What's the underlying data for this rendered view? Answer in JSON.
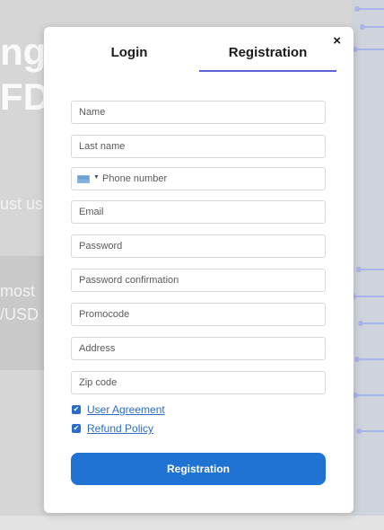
{
  "background": {
    "big_text_1": "ng",
    "big_text_2": "FD",
    "text_1": "ust us",
    "text_2": "most",
    "text_3": "/USD"
  },
  "modal": {
    "close_label": "×",
    "tabs": [
      {
        "label": "Login",
        "active": false
      },
      {
        "label": "Registration",
        "active": true
      }
    ],
    "fields": {
      "name": {
        "placeholder": "Name",
        "value": ""
      },
      "last_name": {
        "placeholder": "Last name",
        "value": ""
      },
      "phone": {
        "placeholder": "Phone number",
        "value": "",
        "flag": "flag-icon"
      },
      "email": {
        "placeholder": "Email",
        "value": ""
      },
      "password": {
        "placeholder": "Password",
        "value": ""
      },
      "password_confirmation": {
        "placeholder": "Password confirmation",
        "value": ""
      },
      "promocode": {
        "placeholder": "Promocode",
        "value": ""
      },
      "address": {
        "placeholder": "Address",
        "value": ""
      },
      "zip_code": {
        "placeholder": "Zip code",
        "value": ""
      }
    },
    "checkboxes": [
      {
        "label": "User Agreement",
        "checked": true
      },
      {
        "label": "Refund Policy",
        "checked": true
      }
    ],
    "submit_label": "Registration",
    "colors": {
      "accent": "#1f73d3",
      "tab_underline": "#5b63d6",
      "link": "#2a6cc6"
    }
  }
}
